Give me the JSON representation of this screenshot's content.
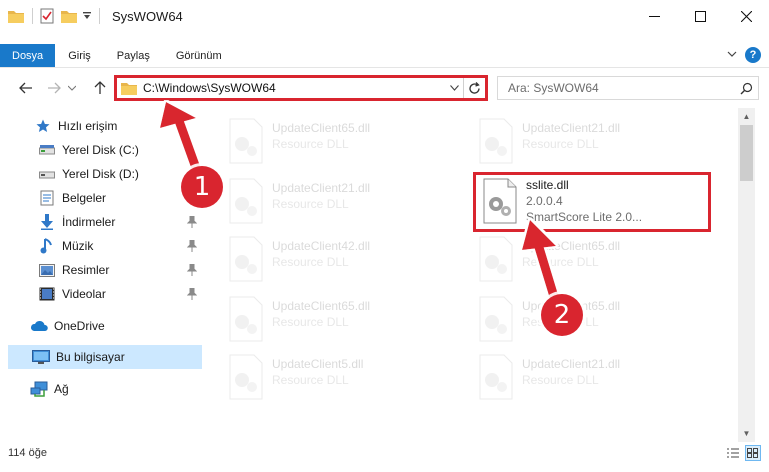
{
  "window": {
    "title": "SysWOW64",
    "minimize_glyph": "—",
    "maximize_glyph": "☐",
    "close_glyph": "✕"
  },
  "ribbon": {
    "tabs": [
      {
        "label": "Dosya",
        "active": true
      },
      {
        "label": "Giriş"
      },
      {
        "label": "Paylaş"
      },
      {
        "label": "Görünüm"
      }
    ],
    "collapse_glyph": "⌄",
    "help_glyph": "?"
  },
  "navigation": {
    "back_glyph": "←",
    "forward_glyph": "→",
    "recent_glyph": "⌄",
    "up_glyph": "↑",
    "address": "C:\\Windows\\SysWOW64",
    "address_drop_glyph": "⌄",
    "refresh_glyph": "↻",
    "search_placeholder": "Ara: SysWOW64"
  },
  "sidebar": {
    "items": [
      {
        "label": "Hızlı erişim",
        "icon": "star-icon"
      },
      {
        "label": "Yerel Disk (C:)",
        "icon": "drive-icon",
        "pinned": true
      },
      {
        "label": "Yerel Disk (D:)",
        "icon": "drive-icon",
        "pinned": true
      },
      {
        "label": "Belgeler",
        "icon": "documents-icon",
        "pinned": true
      },
      {
        "label": "İndirmeler",
        "icon": "downloads-icon",
        "pinned": true
      },
      {
        "label": "Müzik",
        "icon": "music-icon",
        "pinned": true
      },
      {
        "label": "Resimler",
        "icon": "pictures-icon",
        "pinned": true
      },
      {
        "label": "Videolar",
        "icon": "videos-icon",
        "pinned": true
      },
      {
        "label": "OneDrive",
        "icon": "cloud-icon"
      },
      {
        "label": "Bu bilgisayar",
        "icon": "computer-icon",
        "selected": true
      },
      {
        "label": "Ağ",
        "icon": "network-icon"
      }
    ]
  },
  "files": {
    "left_column": [
      {
        "name": "UpdateClient65.dll",
        "type": "Resource DLL"
      },
      {
        "name": "UpdateClient21.dll",
        "type": "Resource DLL"
      },
      {
        "name": "UpdateClient42.dll",
        "type": "Resource DLL"
      },
      {
        "name": "UpdateClient65.dll",
        "type": "Resource DLL"
      },
      {
        "name": "UpdateClient5.dll",
        "type": "Resource DLL"
      }
    ],
    "right_column": [
      {
        "name": "UpdateClient21.dll",
        "type": "Resource DLL"
      },
      {
        "name": "UpdateClient65.dll",
        "type": "Resource DLL"
      },
      {
        "name": "UpdateClient65.dll",
        "type": "Resource DLL"
      },
      {
        "name": "UpdateClient21.dll",
        "type": "Resource DLL"
      }
    ],
    "highlighted": {
      "name": "sslite.dll",
      "version": "2.0.0.4",
      "description": "SmartScore Lite 2.0..."
    }
  },
  "scrollbar": {
    "up_glyph": "▲",
    "down_glyph": "▼"
  },
  "status": {
    "item_count": "114 öğe"
  },
  "annotations": {
    "step1": "1",
    "step2": "2",
    "color": "#d9252f"
  },
  "colors": {
    "accent": "#1979ca",
    "selection": "#cce8ff",
    "highlight": "#d9252f"
  }
}
